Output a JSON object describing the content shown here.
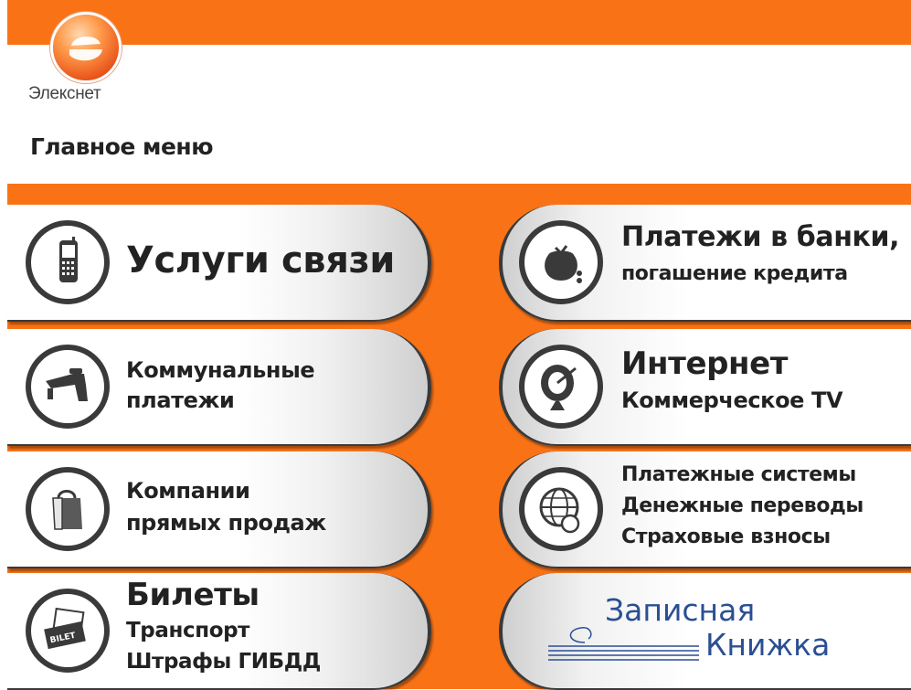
{
  "brand": {
    "name": "Элекснет"
  },
  "page": {
    "title": "Главное меню"
  },
  "menu": {
    "communication": {
      "label": "Услуги связи",
      "icon": "mobile-phone-icon"
    },
    "utilities": {
      "line1": "Коммунальные",
      "line2": "платежи",
      "icon": "faucet-icon"
    },
    "direct_sales": {
      "line1": "Компании",
      "line2": "прямых продаж",
      "icon": "shopping-bag-icon"
    },
    "tickets": {
      "line1": "Билеты",
      "line2": "Транспорт",
      "line3": "Штрафы ГИБДД",
      "icon": "ticket-icon"
    },
    "banks": {
      "line1": "Платежи в банки,",
      "line2": "погашение кредита",
      "icon": "money-bag-icon"
    },
    "internet": {
      "line1": "Интернет",
      "line2": "Коммерческое TV",
      "icon": "satellite-dish-icon"
    },
    "payment_systems": {
      "line1": "Платежные системы",
      "line2": "Денежные переводы",
      "line3": "Страховые взносы",
      "icon": "globe-coins-icon"
    },
    "notebook": {
      "line1": "Записная",
      "line2": "Книжка"
    }
  },
  "colors": {
    "accent": "#f97316",
    "dark": "#3a3a3a",
    "notebook_blue": "#2a4f93"
  }
}
